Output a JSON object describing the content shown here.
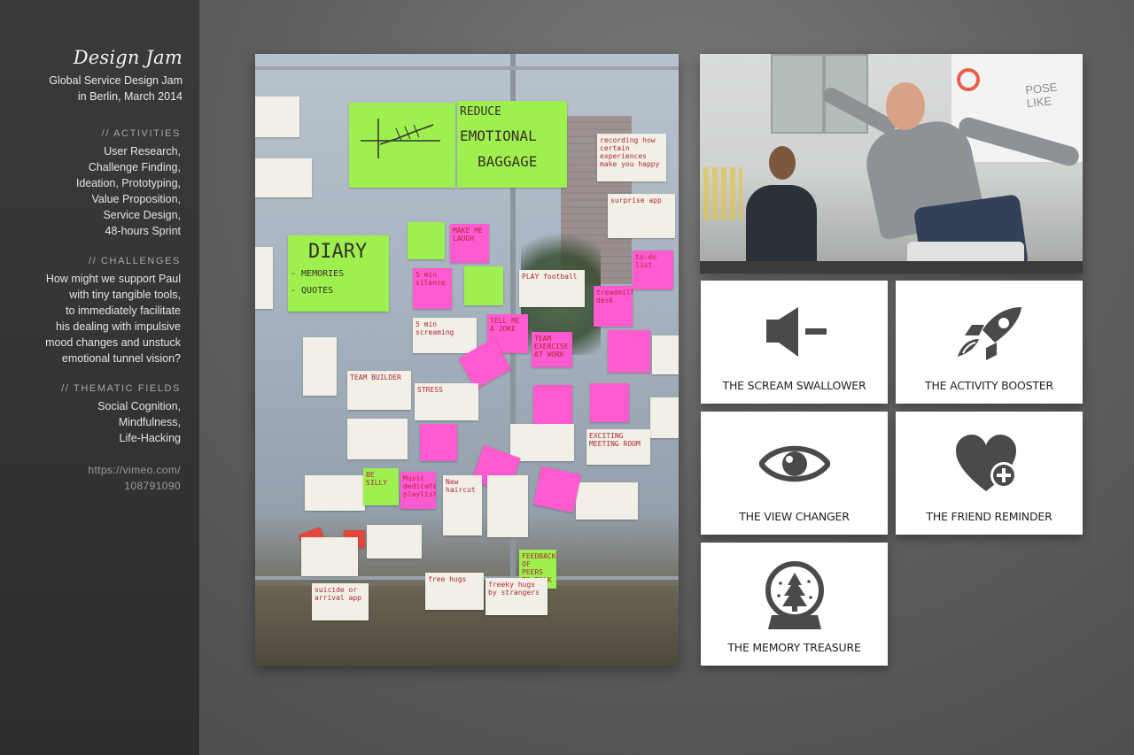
{
  "sidebar": {
    "title": "Design Jam",
    "subtitle_lines": [
      "Global Service Design Jam",
      "in Berlin, March 2014"
    ],
    "activities": {
      "heading": "// ACTIVITIES",
      "lines": [
        "User Research,",
        "Challenge Finding,",
        "Ideation, Prototyping,",
        "Value Proposition,",
        "Service Design,",
        "48-hours Sprint"
      ]
    },
    "challenges": {
      "heading": "// CHALLENGES",
      "lines": [
        "How might we support Paul",
        "with tiny tangible tools,",
        "to immediately facilitate",
        "his dealing with impulsive",
        "mood changes and unstuck",
        "emotional tunnel vision?"
      ]
    },
    "thematic": {
      "heading": "// THEMATIC FIELDS",
      "lines": [
        "Social Cognition,",
        "Mindfulness,",
        "Life-Hacking"
      ]
    },
    "link_lines": [
      "https://vimeo.com/",
      "108791090"
    ]
  },
  "wall_notes": {
    "reduce": [
      "REDUCE",
      "EMOTIONAL",
      "BAGGAGE"
    ],
    "diary": [
      "DIARY",
      "- MEMORIES",
      "- QUOTES"
    ],
    "make_me_laugh": "MAKE ME LAUGH",
    "recording": "recording how certain experiences make you happy",
    "surprise_app": "surprise app",
    "to_do": "to-do list",
    "stress": "STRESS",
    "scream": "5 min screaming",
    "tell_me_a_joke": "TELL ME A JOKE",
    "team_exercise": "TEAM EXERCISE AT WORK",
    "exciting_meeting": "EXCITING MEETING ROOM",
    "be_silly": "BE SILLY",
    "music": "Music dedicated playlist",
    "new_haircut": "New haircut",
    "free_hugs": "free hugs",
    "freeky_hugs": "freeky hugs by strangers",
    "feedback": "FEEDBACK OF PEERS TO TALK WITH",
    "suicide": "suicide or arrival app",
    "team_builder": "TEAM BUILDER",
    "5min_silence": "5 min silence",
    "play_football": "PLAY football",
    "treadmill": "treadmill desk"
  },
  "team_photo": {
    "screen_text": "POSE LIKE"
  },
  "tools": [
    {
      "label": "THE SCREAM SWALLOWER",
      "icon": "speaker-mute-icon"
    },
    {
      "label": "THE ACTIVITY BOOSTER",
      "icon": "rocket-icon"
    },
    {
      "label": "THE VIEW CHANGER",
      "icon": "eye-icon"
    },
    {
      "label": "THE FRIEND REMINDER",
      "icon": "heart-plus-icon"
    },
    {
      "label": "THE MEMORY TREASURE",
      "icon": "snow-globe-icon"
    }
  ],
  "colors": {
    "icon_gray": "#4a4a4a",
    "note_green": "#9ef04e",
    "note_pink": "#ff5bd0",
    "sidebar_bg": "#333333"
  }
}
